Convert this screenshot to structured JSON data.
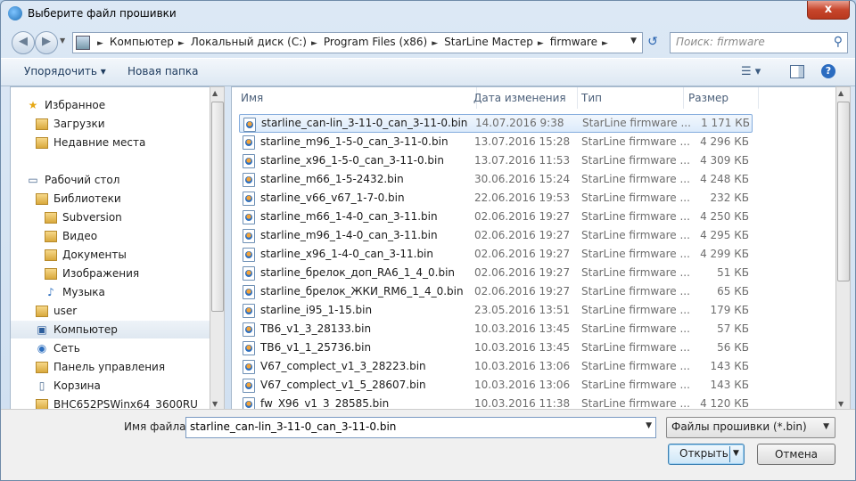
{
  "window": {
    "title": "Выберите файл прошивки",
    "close_label": "x"
  },
  "address": {
    "crumbs": [
      "Компьютер",
      "Локальный диск (C:)",
      "Program Files (x86)",
      "StarLine Мастер",
      "firmware"
    ],
    "search_placeholder": "Поиск: firmware"
  },
  "toolbar": {
    "organize_label": "Упорядочить ▾",
    "new_folder_label": "Новая папка",
    "help_label": "?"
  },
  "sidebar": {
    "items": [
      {
        "label": "Избранное",
        "icon": "star-icon",
        "indent": 0
      },
      {
        "label": "Загрузки",
        "icon": "downloads-folder-icon",
        "indent": 1
      },
      {
        "label": "Недавние места",
        "icon": "recent-places-icon",
        "indent": 1
      },
      {
        "label": "Рабочий стол",
        "icon": "desktop-icon",
        "indent": 0
      },
      {
        "label": "Библиотеки",
        "icon": "libraries-icon",
        "indent": 1
      },
      {
        "label": "Subversion",
        "icon": "document-library-icon",
        "indent": 2
      },
      {
        "label": "Видео",
        "icon": "video-library-icon",
        "indent": 2
      },
      {
        "label": "Документы",
        "icon": "documents-library-icon",
        "indent": 2
      },
      {
        "label": "Изображения",
        "icon": "pictures-library-icon",
        "indent": 2
      },
      {
        "label": "Музыка",
        "icon": "music-library-icon",
        "indent": 2
      },
      {
        "label": "user",
        "icon": "user-folder-icon",
        "indent": 1
      },
      {
        "label": "Компьютер",
        "icon": "computer-icon",
        "indent": 1,
        "selected": true
      },
      {
        "label": "Сеть",
        "icon": "network-icon",
        "indent": 1
      },
      {
        "label": "Панель управления",
        "icon": "control-panel-icon",
        "indent": 1
      },
      {
        "label": "Корзина",
        "icon": "recycle-bin-icon",
        "indent": 1
      },
      {
        "label": "BHC652PSWinx64_3600RU",
        "icon": "folder-icon",
        "indent": 1
      }
    ]
  },
  "columns": {
    "name": "Имя",
    "date": "Дата изменения",
    "type": "Тип",
    "size": "Размер"
  },
  "files": [
    {
      "name": "starline_can-lin_3-11-0_can_3-11-0.bin",
      "date": "14.07.2016 9:38",
      "type": "StarLine firmware ...",
      "size": "1 171 КБ",
      "selected": true
    },
    {
      "name": "starline_m96_1-5-0_can_3-11-0.bin",
      "date": "13.07.2016 15:28",
      "type": "StarLine firmware ...",
      "size": "4 296 КБ"
    },
    {
      "name": "starline_x96_1-5-0_can_3-11-0.bin",
      "date": "13.07.2016 11:53",
      "type": "StarLine firmware ...",
      "size": "4 309 КБ"
    },
    {
      "name": "starline_m66_1-5-2432.bin",
      "date": "30.06.2016 15:24",
      "type": "StarLine firmware ...",
      "size": "4 248 КБ"
    },
    {
      "name": "starline_v66_v67_1-7-0.bin",
      "date": "22.06.2016 19:53",
      "type": "StarLine firmware ...",
      "size": "232 КБ"
    },
    {
      "name": "starline_m66_1-4-0_can_3-11.bin",
      "date": "02.06.2016 19:27",
      "type": "StarLine firmware ...",
      "size": "4 250 КБ"
    },
    {
      "name": "starline_m96_1-4-0_can_3-11.bin",
      "date": "02.06.2016 19:27",
      "type": "StarLine firmware ...",
      "size": "4 295 КБ"
    },
    {
      "name": "starline_x96_1-4-0_can_3-11.bin",
      "date": "02.06.2016 19:27",
      "type": "StarLine firmware ...",
      "size": "4 299 КБ"
    },
    {
      "name": "starline_брелок_доп_RA6_1_4_0.bin",
      "date": "02.06.2016 19:27",
      "type": "StarLine firmware ...",
      "size": "51 КБ"
    },
    {
      "name": "starline_брелок_ЖКИ_RM6_1_4_0.bin",
      "date": "02.06.2016 19:27",
      "type": "StarLine firmware ...",
      "size": "65 КБ"
    },
    {
      "name": "starline_i95_1-15.bin",
      "date": "23.05.2016 13:51",
      "type": "StarLine firmware ...",
      "size": "179 КБ"
    },
    {
      "name": "TB6_v1_3_28133.bin",
      "date": "10.03.2016 13:45",
      "type": "StarLine firmware ...",
      "size": "57 КБ"
    },
    {
      "name": "TB6_v1_1_25736.bin",
      "date": "10.03.2016 13:45",
      "type": "StarLine firmware ...",
      "size": "56 КБ"
    },
    {
      "name": "V67_complect_v1_3_28223.bin",
      "date": "10.03.2016 13:06",
      "type": "StarLine firmware ...",
      "size": "143 КБ"
    },
    {
      "name": "V67_complect_v1_5_28607.bin",
      "date": "10.03.2016 13:06",
      "type": "StarLine firmware ...",
      "size": "143 КБ"
    },
    {
      "name": "fw_X96_v1_3_28585.bin",
      "date": "10.03.2016 11:38",
      "type": "StarLine firmware ...",
      "size": "4 120 КБ"
    }
  ],
  "footer": {
    "filename_label": "Имя файла:",
    "filename_value": "starline_can-lin_3-11-0_can_3-11-0.bin",
    "filter_value": "Файлы прошивки (*.bin)",
    "open_label": "Открыть",
    "cancel_label": "Отмена"
  }
}
